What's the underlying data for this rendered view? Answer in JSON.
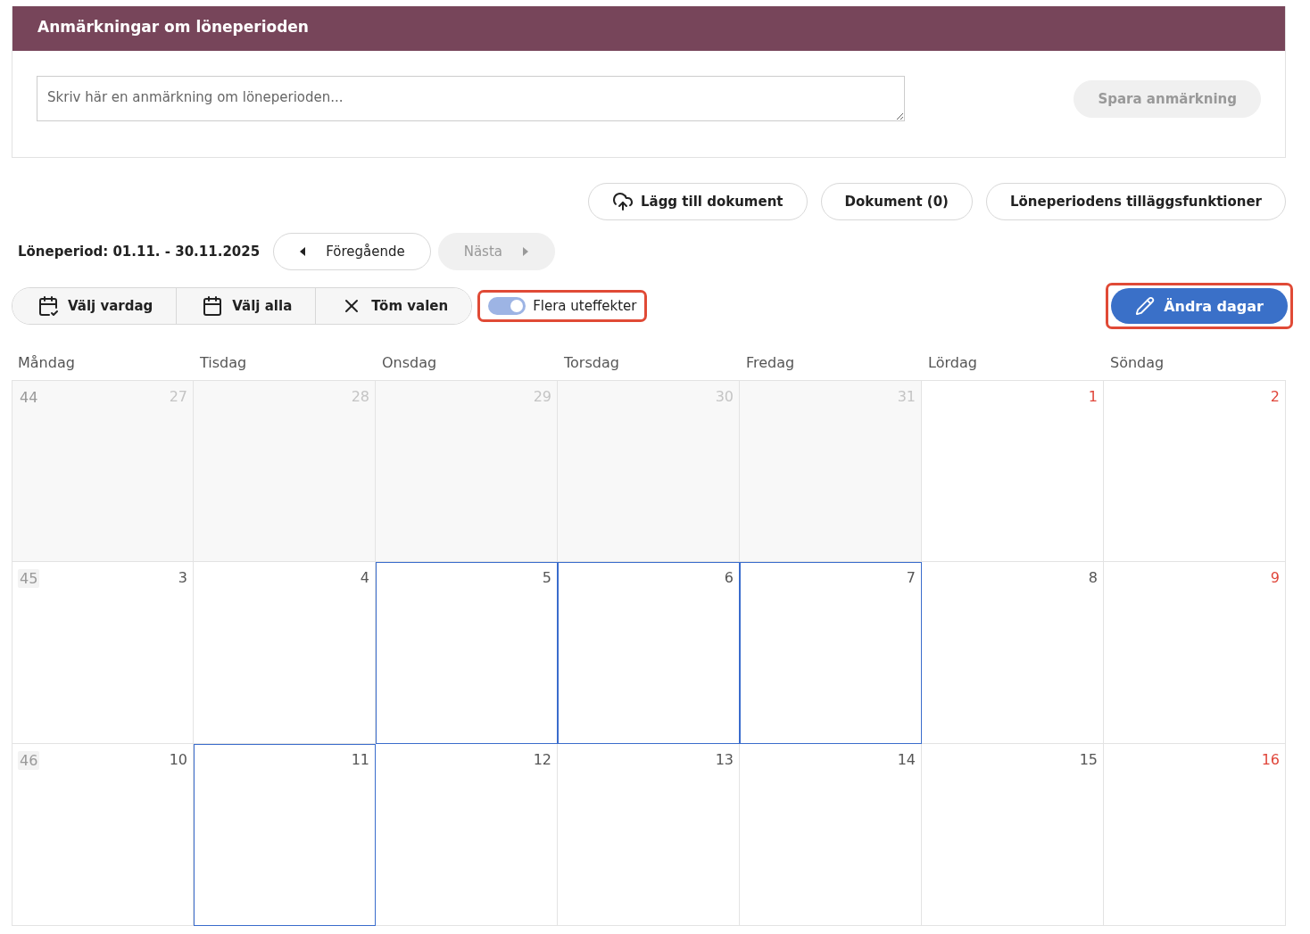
{
  "remarks_panel": {
    "title": "Anmärkningar om löneperioden",
    "field": {
      "placeholder": "Skriv här en anmärkning om löneperioden..."
    },
    "save_button": {
      "label": "Spara anmärkning",
      "disabled": true
    }
  },
  "document_actions": [
    {
      "label": "Lägg till dokument",
      "kind": "upload"
    },
    {
      "label": "Dokument (0)",
      "kind": "plain"
    },
    {
      "label": "Löneperiodens tilläggsfunktioner",
      "kind": "plain"
    }
  ],
  "period": {
    "label": "Löneperiod: 01.11. - 30.11.2025",
    "previous": {
      "label": "Föregående",
      "disabled": false
    },
    "next": {
      "label": "Nästa",
      "disabled": true
    }
  },
  "selection_buttons": [
    {
      "label": "Välj vardag",
      "kind": "calendar-day"
    },
    {
      "label": "Välj alla",
      "kind": "calendar"
    },
    {
      "label": "Töm valen",
      "kind": "clear"
    }
  ],
  "toggle": {
    "label": "Flera uteffekter",
    "on": true,
    "highlighted": true
  },
  "edit_button": {
    "label": "Ändra dagar",
    "highlighted": true
  },
  "weekdays": [
    "Måndag",
    "Tisdag",
    "Onsdag",
    "Torsdag",
    "Fredag",
    "Lördag",
    "Söndag"
  ],
  "weeks": [
    {
      "week": "44",
      "days": [
        {
          "day": "27",
          "in_period": false,
          "holiday": false,
          "selected": false
        },
        {
          "day": "28",
          "in_period": false,
          "holiday": false,
          "selected": false
        },
        {
          "day": "29",
          "in_period": false,
          "holiday": false,
          "selected": false
        },
        {
          "day": "30",
          "in_period": false,
          "holiday": false,
          "selected": false
        },
        {
          "day": "31",
          "in_period": false,
          "holiday": false,
          "selected": false
        },
        {
          "day": "1",
          "in_period": true,
          "holiday": true,
          "selected": false
        },
        {
          "day": "2",
          "in_period": true,
          "holiday": true,
          "selected": false
        }
      ]
    },
    {
      "week": "45",
      "days": [
        {
          "day": "3",
          "in_period": true,
          "holiday": false,
          "selected": false
        },
        {
          "day": "4",
          "in_period": true,
          "holiday": false,
          "selected": false
        },
        {
          "day": "5",
          "in_period": true,
          "holiday": false,
          "selected": true
        },
        {
          "day": "6",
          "in_period": true,
          "holiday": false,
          "selected": true
        },
        {
          "day": "7",
          "in_period": true,
          "holiday": false,
          "selected": true
        },
        {
          "day": "8",
          "in_period": true,
          "holiday": false,
          "selected": false
        },
        {
          "day": "9",
          "in_period": true,
          "holiday": true,
          "selected": false
        }
      ]
    },
    {
      "week": "46",
      "days": [
        {
          "day": "10",
          "in_period": true,
          "holiday": false,
          "selected": false
        },
        {
          "day": "11",
          "in_period": true,
          "holiday": false,
          "selected": true
        },
        {
          "day": "12",
          "in_period": true,
          "holiday": false,
          "selected": false
        },
        {
          "day": "13",
          "in_period": true,
          "holiday": false,
          "selected": false
        },
        {
          "day": "14",
          "in_period": true,
          "holiday": false,
          "selected": false
        },
        {
          "day": "15",
          "in_period": true,
          "holiday": false,
          "selected": false
        },
        {
          "day": "16",
          "in_period": true,
          "holiday": true,
          "selected": false
        }
      ]
    }
  ]
}
